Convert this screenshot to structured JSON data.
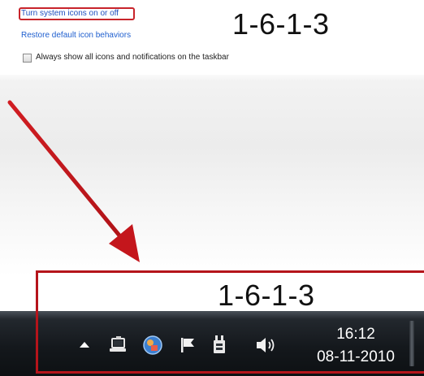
{
  "settings_panel": {
    "turn_system_icons_link": "Turn system icons on or off",
    "restore_defaults_link": "Restore default icon behaviors",
    "always_show_checkbox_label": "Always show all icons and notifications on the taskbar",
    "always_show_checked": false
  },
  "annotations": {
    "step_label_top": "1-6-1-3",
    "step_label_bottom": "1-6-1-3",
    "highlight_color": "#c8242b",
    "arrow_color": "#c4161c"
  },
  "taskbar": {
    "tray_icons": [
      "show-hidden-icons-arrow-icon",
      "network-icon",
      "app-icon",
      "action-center-flag-icon",
      "power-icon",
      "volume-icon"
    ],
    "clock": {
      "time": "16:12",
      "date": "08-11-2010"
    }
  }
}
